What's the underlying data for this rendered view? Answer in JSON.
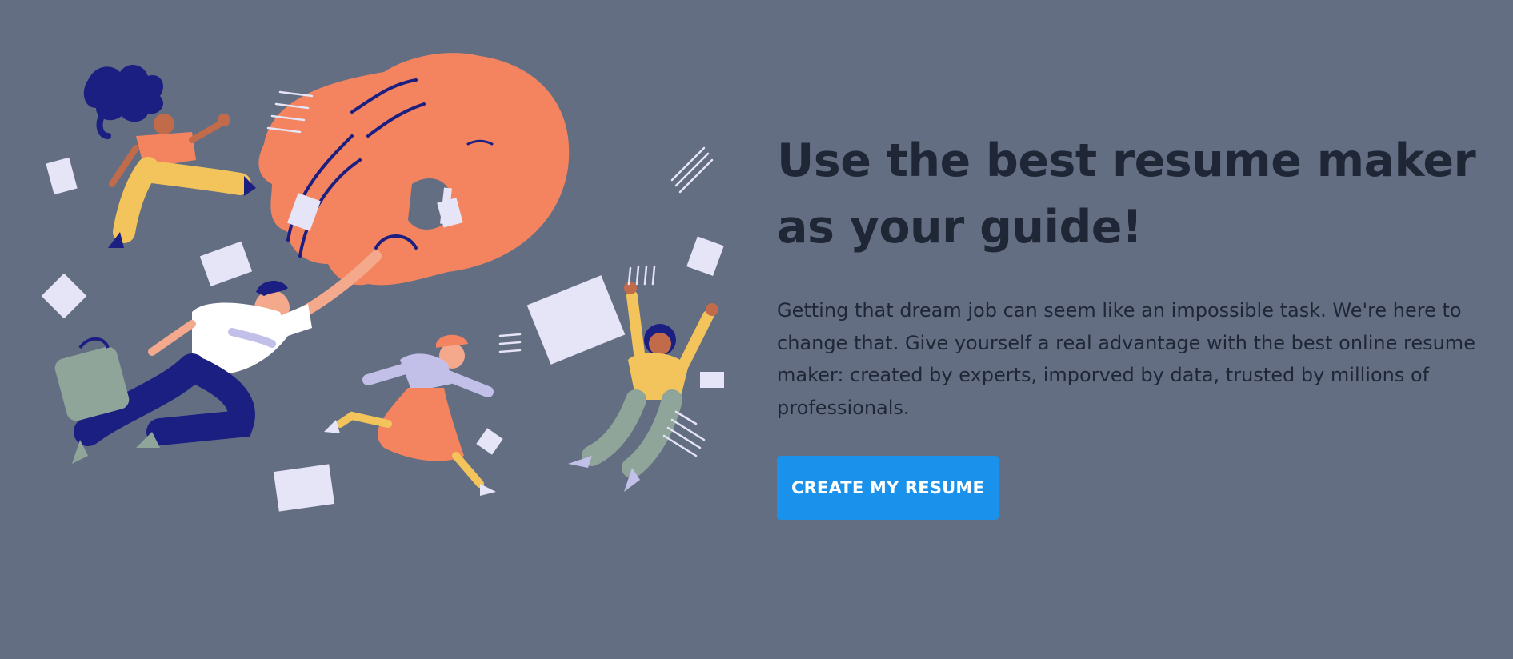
{
  "hero": {
    "title_line1": "Use the best resume maker",
    "title_line2": "as your guide!",
    "subtitle": "Getting that dream job can seem like an impossible task. We're here to change that. Give yourself a real advantage with the best online resume maker: created by experts, imporved by data, trusted by millions of professionals.",
    "cta_label": "CREATE MY RESUME"
  },
  "colors": {
    "background": "#646e83",
    "heading": "#1f2736",
    "cta": "#1a91ea",
    "hand": "#f3845f",
    "navy": "#1c1f82",
    "mustard": "#f2c45b",
    "lavender": "#c2c0e8",
    "sage": "#8fa59a"
  },
  "illustration": {
    "icons": [
      "giant-hand-icon",
      "woman-curly-hair-icon",
      "man-briefcase-icon",
      "woman-red-hair-icon",
      "woman-yellow-sweater-icon",
      "paper-sheet-icon",
      "motion-lines-icon"
    ]
  }
}
